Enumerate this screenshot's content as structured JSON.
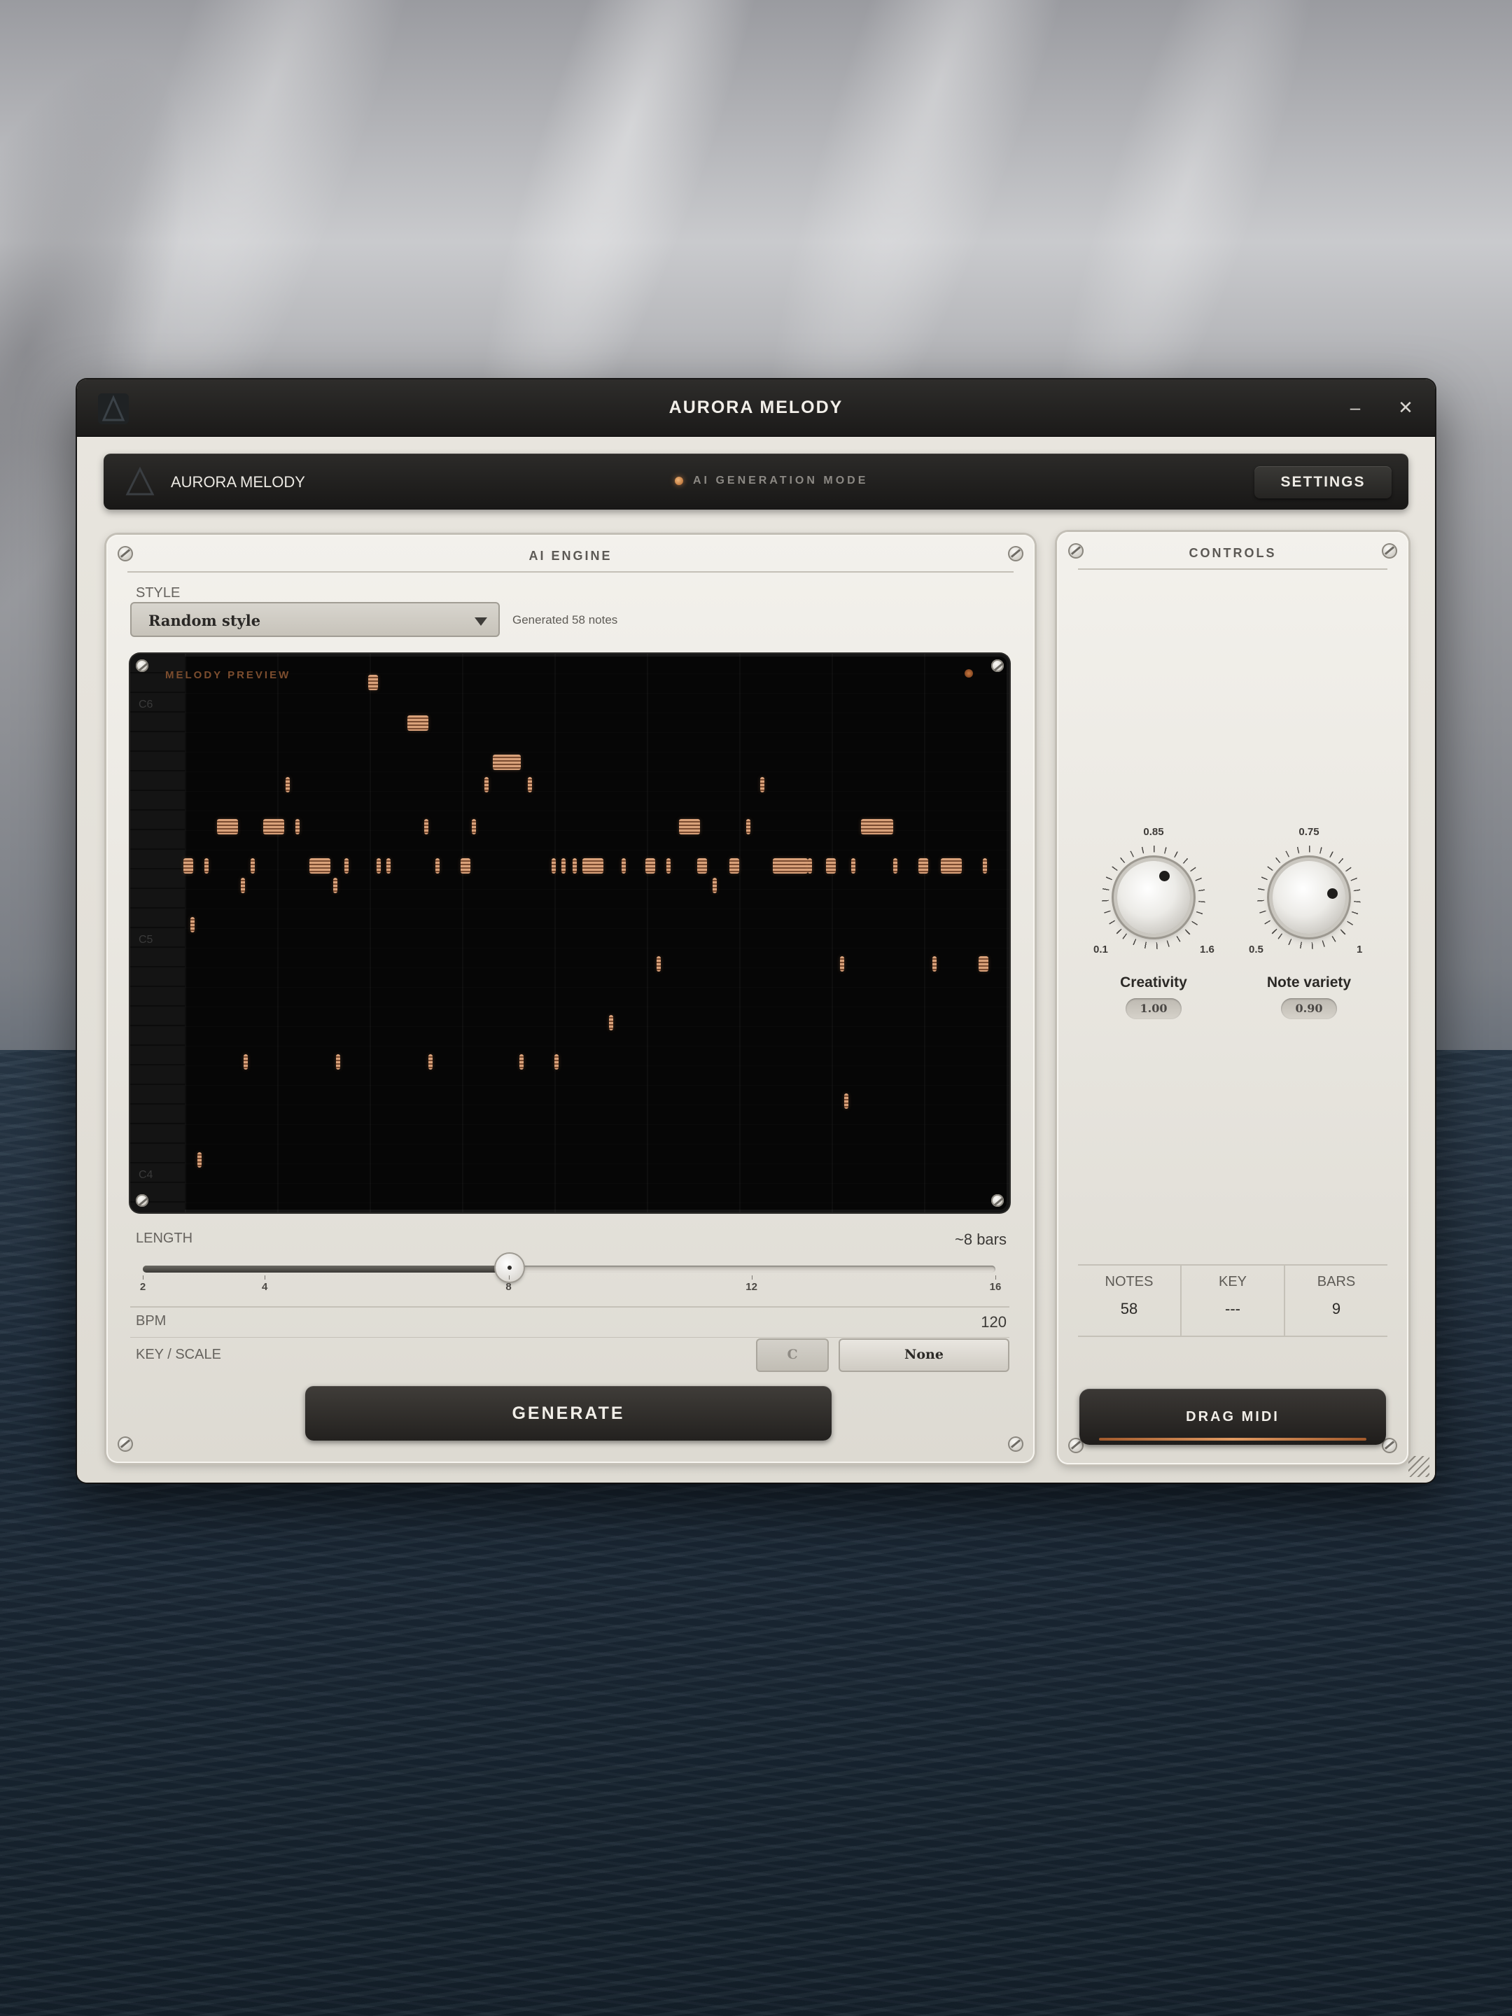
{
  "window": {
    "title": "AURORA MELODY",
    "minimize": "–",
    "close": "✕"
  },
  "toolbar": {
    "brand": "AURORA MELODY",
    "mode": "AI GENERATION MODE",
    "settings": "SETTINGS"
  },
  "ai_engine": {
    "title": "AI ENGINE",
    "style_label": "STYLE",
    "style_value": "Random style",
    "status": "Generated 58 notes",
    "preview_title": "MELODY PREVIEW",
    "octave_labels": [
      "C6",
      "C5",
      "C4"
    ],
    "length_label": "LENGTH",
    "length_value": "~8 bars",
    "length_ticks": [
      "2",
      "4",
      "8",
      "12",
      "16"
    ],
    "length_fraction": 0.43,
    "bpm_label": "BPM",
    "bpm_value": "120",
    "key_label": "KEY / SCALE",
    "key_root": "C",
    "key_scale": "None",
    "generate": "GENERATE"
  },
  "controls": {
    "title": "CONTROLS",
    "knobs": [
      {
        "name": "Creativity",
        "value": "1.00",
        "top": "0.85",
        "min": "0.1",
        "max": "1.6",
        "fraction": 0.6
      },
      {
        "name": "Note variety",
        "value": "0.90",
        "top": "0.75",
        "min": "0.5",
        "max": "1",
        "fraction": 0.8
      }
    ],
    "stats": [
      {
        "label": "NOTES",
        "value": "58"
      },
      {
        "label": "KEY",
        "value": "---"
      },
      {
        "label": "BARS",
        "value": "9"
      }
    ],
    "drag": "DRAG MIDI"
  },
  "icons": {
    "app": "aurora-logo-icon",
    "minimize": "minimize-icon",
    "close": "close-icon",
    "dropdown": "chevron-down-icon"
  },
  "colors": {
    "accent": "#d9a17a",
    "panel": "#efece6",
    "dark": "#1b1a19"
  }
}
